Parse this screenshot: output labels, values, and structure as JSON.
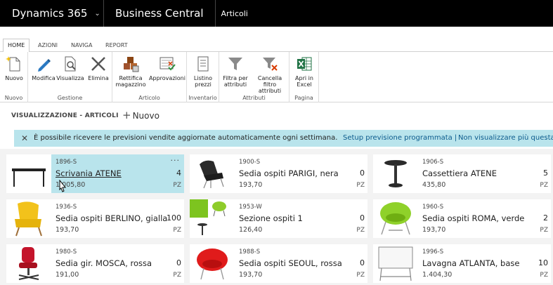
{
  "topbar": {
    "product": "Dynamics 365",
    "app": "Business Central",
    "page": "Articoli"
  },
  "tabs": [
    "HOME",
    "AZIONI",
    "NAVIGA",
    "REPORT"
  ],
  "ribbon": {
    "groups": [
      {
        "label": "Nuovo",
        "buttons": [
          "Nuovo"
        ]
      },
      {
        "label": "Gestione",
        "buttons": [
          "Modifica",
          "Visualizza",
          "Elimina"
        ]
      },
      {
        "label": "Articolo",
        "buttons": [
          "Rettifica magazzino",
          "Approvazioni"
        ]
      },
      {
        "label": "Inventario",
        "buttons": [
          "Listino prezzi"
        ]
      },
      {
        "label": "Attributi",
        "buttons": [
          "Filtra per attributi",
          "Cancella filtro attributi"
        ]
      },
      {
        "label": "Pagina",
        "buttons": [
          "Apri in Excel"
        ]
      }
    ]
  },
  "section": {
    "title": "VISUALIZZAZIONE - ARTICOLI",
    "new_label": "Nuovo"
  },
  "notification": {
    "message": "È possibile ricevere le previsioni vendite aggiornate automaticamente ogni settimana.",
    "link1": "Setup previsione programmata |",
    "link2": "Non visualizzare più questa"
  },
  "items": [
    {
      "no": "1896-S",
      "desc": "Scrivania ATENE",
      "qty": "4",
      "price": "1.005,80",
      "uom": "PZ",
      "selected": true
    },
    {
      "no": "1900-S",
      "desc": "Sedia ospiti PARIGI, nera",
      "qty": "0",
      "price": "193,70",
      "uom": "PZ"
    },
    {
      "no": "1906-S",
      "desc": "Cassettiera ATENE",
      "qty": "5",
      "price": "435,80",
      "uom": "PZ"
    },
    {
      "no": "1936-S",
      "desc": "Sedia ospiti BERLINO, gialla",
      "qty": "100",
      "price": "193,70",
      "uom": "PZ"
    },
    {
      "no": "1953-W",
      "desc": "Sezione ospiti 1",
      "qty": "0",
      "price": "126,40",
      "uom": "PZ"
    },
    {
      "no": "1960-S",
      "desc": "Sedia ospiti ROMA, verde",
      "qty": "2",
      "price": "193,70",
      "uom": "PZ"
    },
    {
      "no": "1980-S",
      "desc": "Sedia gir. MOSCA, rossa",
      "qty": "0",
      "price": "191,00",
      "uom": "PZ"
    },
    {
      "no": "1988-S",
      "desc": "Sedia ospiti SEOUL, rossa",
      "qty": "0",
      "price": "193,70",
      "uom": "PZ"
    },
    {
      "no": "1996-S",
      "desc": "Lavagna ATLANTA, base",
      "qty": "10",
      "price": "1.404,30",
      "uom": "PZ"
    }
  ]
}
